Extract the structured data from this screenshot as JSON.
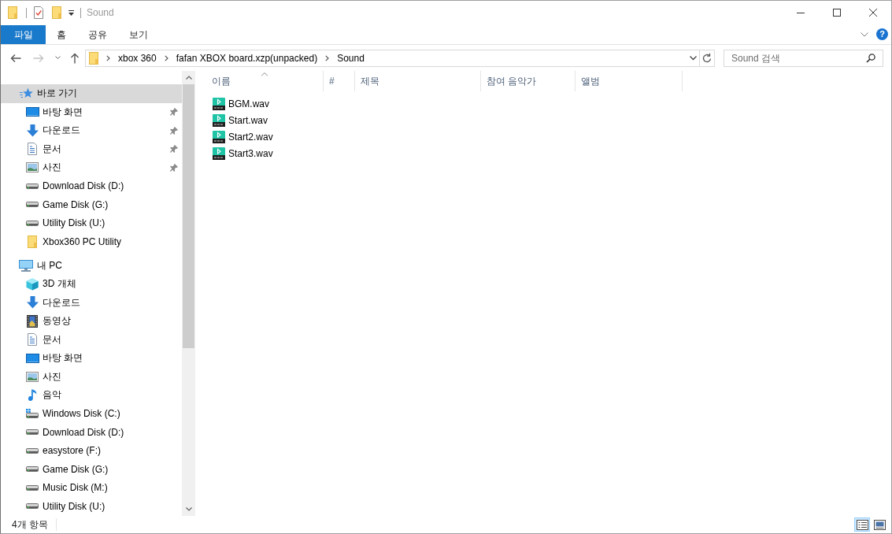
{
  "window": {
    "title": "Sound"
  },
  "ribbon": {
    "tabs": [
      {
        "label": "파일",
        "kind": "file"
      },
      {
        "label": "홈",
        "kind": "tab"
      },
      {
        "label": "공유",
        "kind": "tab"
      },
      {
        "label": "보기",
        "kind": "tab"
      }
    ],
    "help": "?"
  },
  "address_bar": {
    "path": [
      "xbox 360",
      "fafan XBOX board.xzp(unpacked)",
      "Sound"
    ]
  },
  "search": {
    "placeholder": "Sound 검색"
  },
  "navigation_pane": {
    "items": [
      {
        "label": "바로 가기",
        "kind": "shortcuts",
        "selected": true,
        "children": [
          {
            "label": "바탕 화면",
            "kind": "desktop",
            "pinned": true,
            "selected": false
          },
          {
            "label": "다운로드",
            "kind": "download",
            "pinned": true,
            "selected": false
          },
          {
            "label": "문서",
            "kind": "document",
            "pinned": true,
            "selected": false
          },
          {
            "label": "사진",
            "kind": "picture",
            "pinned": true,
            "selected": false
          },
          {
            "label": "Download Disk (D:)",
            "kind": "drive",
            "pinned": false,
            "selected": false
          },
          {
            "label": "Game Disk (G:)",
            "kind": "drive",
            "pinned": false,
            "selected": false
          },
          {
            "label": "Utility Disk (U:)",
            "kind": "drive",
            "pinned": false,
            "selected": false
          },
          {
            "label": "Xbox360 PC Utility",
            "kind": "folder",
            "pinned": false,
            "selected": false
          }
        ]
      },
      {
        "label": "내 PC",
        "kind": "pc",
        "selected": false,
        "children": [
          {
            "label": "3D 개체",
            "kind": "objects",
            "pinned": false,
            "selected": false
          },
          {
            "label": "다운로드",
            "kind": "download",
            "pinned": false,
            "selected": false
          },
          {
            "label": "동영상",
            "kind": "video",
            "pinned": false,
            "selected": false
          },
          {
            "label": "문서",
            "kind": "document",
            "pinned": false,
            "selected": false
          },
          {
            "label": "바탕 화면",
            "kind": "desktop",
            "pinned": false,
            "selected": false
          },
          {
            "label": "사진",
            "kind": "picture",
            "pinned": false,
            "selected": false
          },
          {
            "label": "음악",
            "kind": "music",
            "pinned": false,
            "selected": false
          },
          {
            "label": "Windows Disk (C:)",
            "kind": "windows",
            "pinned": false,
            "selected": false
          },
          {
            "label": "Download Disk (D:)",
            "kind": "drive",
            "pinned": false,
            "selected": false
          },
          {
            "label": "easystore (F:)",
            "kind": "drive",
            "pinned": false,
            "selected": false
          },
          {
            "label": "Game Disk (G:)",
            "kind": "drive",
            "pinned": false,
            "selected": false
          },
          {
            "label": "Music Disk (M:)",
            "kind": "drive",
            "pinned": false,
            "selected": false
          },
          {
            "label": "Utility Disk (U:)",
            "kind": "drive",
            "pinned": false,
            "selected": false
          }
        ]
      }
    ]
  },
  "file_list": {
    "columns": [
      {
        "label": "이름",
        "sorted": true
      },
      {
        "label": "#",
        "sorted": false
      },
      {
        "label": "제목",
        "sorted": false
      },
      {
        "label": "참여 음악가",
        "sorted": false
      },
      {
        "label": "앨범",
        "sorted": false
      }
    ],
    "files": [
      {
        "name": "BGM.wav"
      },
      {
        "name": "Start.wav"
      },
      {
        "name": "Start2.wav"
      },
      {
        "name": "Start3.wav"
      }
    ]
  },
  "status_bar": {
    "item_count": "4개 항목",
    "views": [
      {
        "kind": "details",
        "selected": true
      },
      {
        "kind": "icons",
        "selected": false
      }
    ]
  }
}
